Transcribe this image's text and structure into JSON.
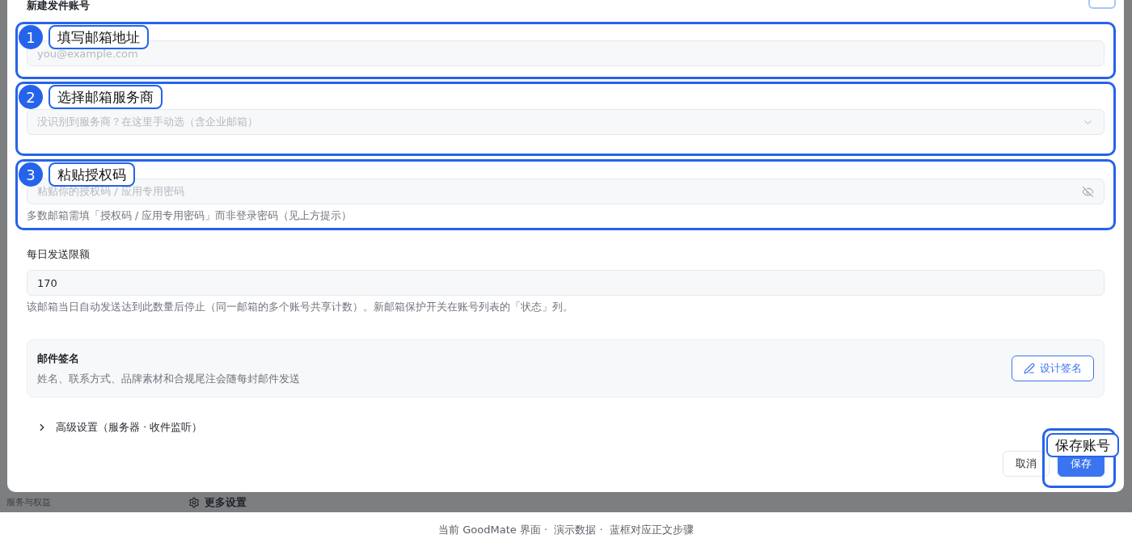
{
  "dialog": {
    "title": "新建发件账号",
    "fields": [
      {
        "kind": "text",
        "placeholder": "you@example.com"
      },
      {
        "kind": "select",
        "placeholder": "没识别到服务商？在这里手动选（含企业邮箱）"
      },
      {
        "kind": "password",
        "placeholder": "粘贴你的授权码 / 应用专用密码",
        "hint": "多数邮箱需填「授权码 / 应用专用密码」而非登录密码（见上方提示）"
      },
      {
        "kind": "text",
        "label": "每日发送限额",
        "value": "170",
        "hint": "该邮箱当日自动发送达到此数量后停止（同一邮箱的多个账号共享计数）。新邮箱保护开关在账号列表的「状态」列。"
      }
    ],
    "signature": {
      "title": "邮件签名",
      "description": "姓名、联系方式、品牌素材和合规尾注会随每封邮件发送",
      "button": "设计签名"
    },
    "advanced": {
      "label": "高级设置（服务器 · 收件监听）",
      "expanded": false
    },
    "buttons": [
      {
        "label": "取消",
        "kind": "secondary"
      },
      {
        "label": "保存",
        "kind": "primary"
      }
    ]
  },
  "annotations": [
    {
      "number": "1",
      "label": "填写邮箱地址"
    },
    {
      "number": "2",
      "label": "选择邮箱服务商"
    },
    {
      "number": "3",
      "label": "粘贴授权码"
    },
    {
      "label": "保存账号"
    }
  ],
  "background": {
    "sidebar_label": "服务与权益",
    "section_title": "更多设置"
  },
  "caption": "当前 GoodMate 界面 ·  演示数据 ·  蓝框对应正文步骤"
}
